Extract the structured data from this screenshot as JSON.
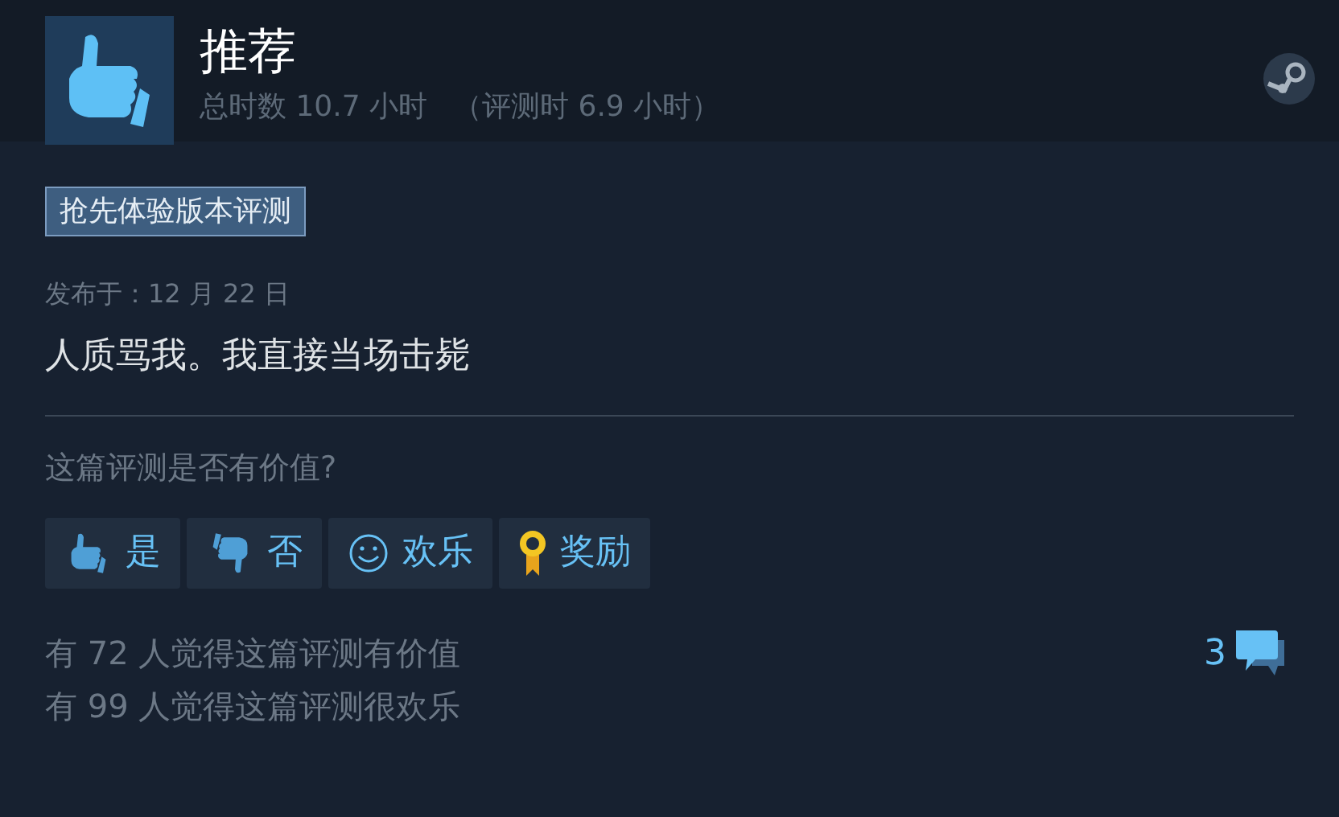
{
  "review": {
    "recommended": true,
    "verdict": "推荐",
    "hours": "总时数 10.7 小时",
    "hours_at_review": "（评测时 6.9 小时）",
    "badge": "抢先体验版本评测",
    "posted": "发布于：12 月 22 日",
    "text": "人质骂我。我直接当场击毙"
  },
  "helpful": {
    "question": "这篇评测是否有价值?",
    "buttons": [
      {
        "kind": "yes",
        "label": "是"
      },
      {
        "kind": "no",
        "label": "否"
      },
      {
        "kind": "funny",
        "label": "欢乐"
      },
      {
        "kind": "award",
        "label": "奖励"
      }
    ]
  },
  "stats": [
    "有 72 人觉得这篇评测有价值",
    "有 99 人觉得这篇评测很欢乐"
  ],
  "comments": {
    "count": "3"
  }
}
